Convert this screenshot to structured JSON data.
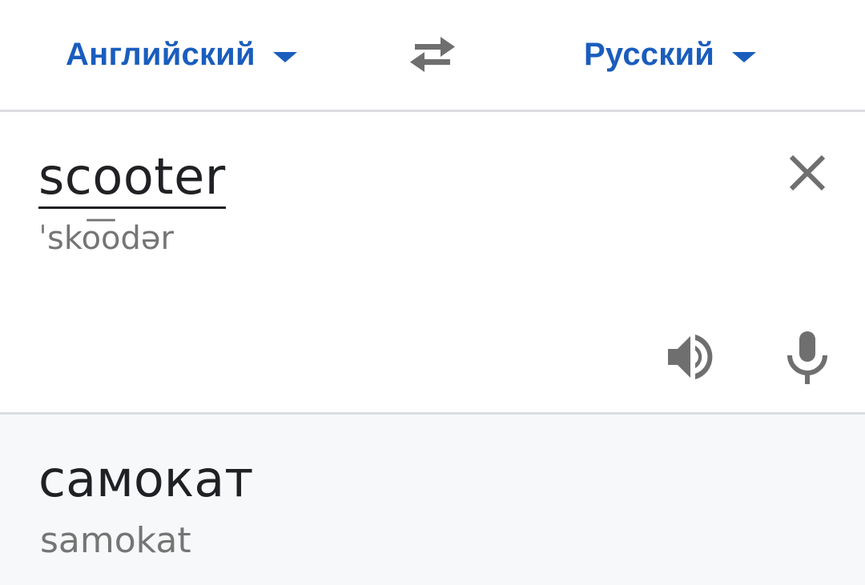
{
  "language_bar": {
    "source_language": "Английский",
    "target_language": "Русский",
    "swap_icon": "swap-arrows-icon"
  },
  "input": {
    "text": "scooter",
    "transliteration": "ˈsko͞odər",
    "clear_icon": "close-icon",
    "speaker_icon": "speaker-icon",
    "mic_icon": "microphone-icon"
  },
  "result": {
    "text": "самокат",
    "transliteration": "samokat"
  },
  "colors": {
    "accent": "#1a5dbd",
    "text_primary": "#202124",
    "text_secondary": "#757575",
    "icon": "#6f6f6f",
    "divider": "#dcdde0",
    "result_background": "#f7f8f9"
  }
}
